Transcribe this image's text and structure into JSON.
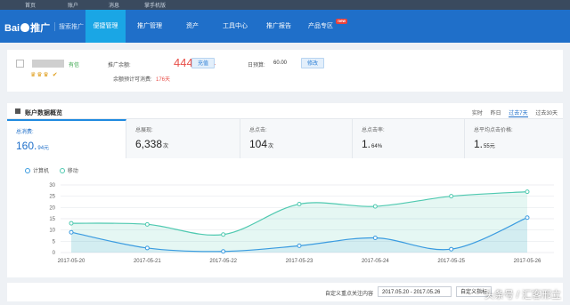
{
  "topbar": {
    "links": [
      "首页",
      "账户",
      "消息",
      "掌手机版"
    ]
  },
  "nav": {
    "logo_left": "Bai",
    "logo_right": "推广",
    "logo_sub": "搜索推广",
    "tabs": [
      "便捷管理",
      "推广管理",
      "资产",
      "工具中心",
      "推广报告",
      "产品专区"
    ],
    "active_tab": "便捷管理",
    "new_badge": "new"
  },
  "account": {
    "verified": "有信",
    "medals": "♛♛♛ ✔",
    "balance_label": "推广余额:",
    "balance": "4441.44",
    "recharge_label": "充值",
    "est_label": "余额预计可消费:",
    "est_days": "176天",
    "budget_label": "日预算:",
    "budget": "60.00",
    "modify_label": "修改"
  },
  "dashboard": {
    "title": "账户数据概览",
    "ranges": [
      "实时",
      "昨日",
      "过去7天",
      "过去30天"
    ],
    "selected_range": "过去7天",
    "stats": [
      {
        "label": "总消费:",
        "value": "160.",
        "unit": "94元"
      },
      {
        "label": "总展现:",
        "value": "6,338",
        "unit": "次"
      },
      {
        "label": "总点击:",
        "value": "104",
        "unit": "次"
      },
      {
        "label": "总点击率:",
        "value": "1.",
        "unit": "64%"
      },
      {
        "label": "总平均点击价格:",
        "value": "1.",
        "unit": "55元"
      }
    ],
    "legend": [
      "计算机",
      "移动"
    ]
  },
  "chart_data": {
    "type": "area",
    "x": [
      "2017-05-20",
      "2017-05-21",
      "2017-05-22",
      "2017-05-23",
      "2017-05-24",
      "2017-05-25",
      "2017-05-26"
    ],
    "yticks": [
      0,
      5,
      10,
      15,
      20,
      25,
      30
    ],
    "ylim": [
      0,
      30
    ],
    "grid": true,
    "series": [
      {
        "name": "计算机",
        "color": "#3a9be0",
        "values": [
          9,
          2,
          0.5,
          3,
          6.5,
          1.5,
          15.5
        ]
      },
      {
        "name": "移动",
        "color": "#4fc9b0",
        "values": [
          13,
          12.5,
          8,
          21.5,
          20.5,
          25,
          27
        ]
      }
    ]
  },
  "bottom": {
    "custom_label": "自定义重点关注内容",
    "date_range": "2017.05.20 - 2017.05.26",
    "custom_button": "自定义指标"
  },
  "watermark": "头条号 / 汇客邢立"
}
